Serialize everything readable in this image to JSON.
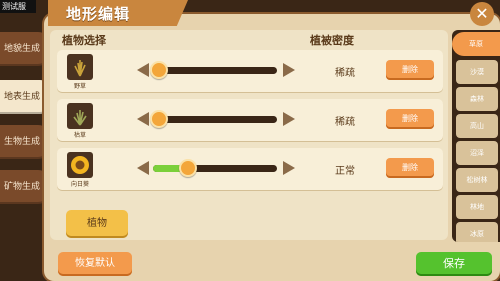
{
  "test_tag": "测试服",
  "left_tabs": [
    {
      "label": "地貌生成",
      "active": false
    },
    {
      "label": "地表生成",
      "active": true
    },
    {
      "label": "生物生成",
      "active": false
    },
    {
      "label": "矿物生成",
      "active": false
    }
  ],
  "title": "地形编辑",
  "close_glyph": "✕",
  "headers": {
    "plant_select": "植物选择",
    "density": "植被密度"
  },
  "plants": [
    {
      "name": "野草",
      "density_label": "稀疏",
      "density_value": 0.05,
      "delete_label": "删除",
      "icon": "grass-icon"
    },
    {
      "name": "枯草",
      "density_label": "稀疏",
      "density_value": 0.05,
      "delete_label": "删除",
      "icon": "dry-grass-icon"
    },
    {
      "name": "向日葵",
      "density_label": "正常",
      "density_value": 0.28,
      "delete_label": "删除",
      "icon": "sunflower-icon"
    }
  ],
  "plant_button": "植物",
  "reset_button": "恢复默认",
  "save_button": "保存",
  "right_tabs": [
    {
      "label": "草原",
      "active": true
    },
    {
      "label": "沙漠",
      "active": false
    },
    {
      "label": "森林",
      "active": false
    },
    {
      "label": "高山",
      "active": false
    },
    {
      "label": "沼泽",
      "active": false
    },
    {
      "label": "松树林",
      "active": false
    },
    {
      "label": "林地",
      "active": false
    },
    {
      "label": "冰原",
      "active": false
    }
  ],
  "colors": {
    "accent": "#f39a4c",
    "save": "#55c22e",
    "slider_fill": "#7bd03a"
  }
}
